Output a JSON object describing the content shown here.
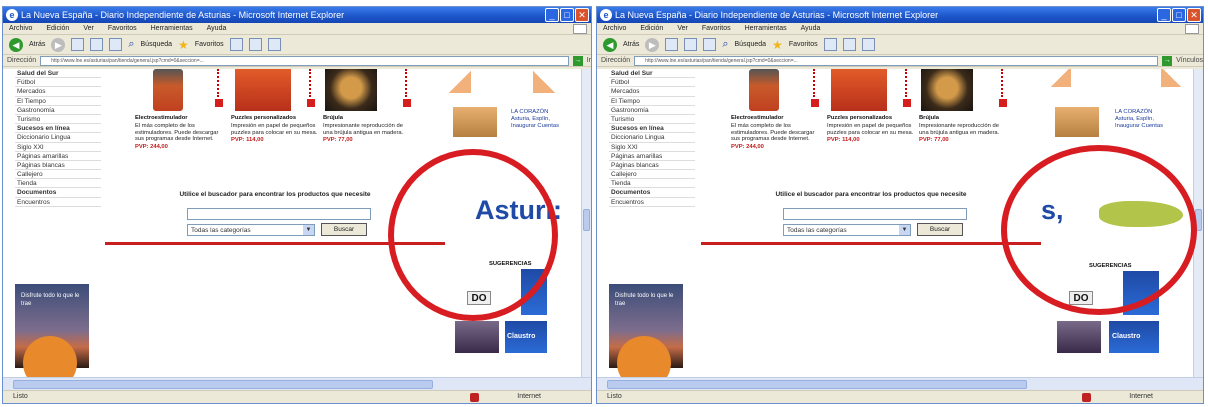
{
  "window": {
    "title": "La Nueva España - Diario Independiente de Asturias - Microsoft Internet Explorer",
    "menu": [
      "Archivo",
      "Edición",
      "Ver",
      "Favoritos",
      "Herramientas",
      "Ayuda"
    ],
    "back_label": "Atrás",
    "search_label": "Búsqueda",
    "favorites_label": "Favoritos",
    "address_label": "Dirección",
    "address_url": "http://www.lne.es/asturias/pan/tienda/general.jsp?cmd=0&seccion=...",
    "go_label": "Ir",
    "links_label": "Vínculos",
    "status_left": "Listo",
    "status_zone": "Internet"
  },
  "left_nav": [
    {
      "label": "Salud del Sur",
      "bold": true
    },
    {
      "label": "Fútbol",
      "bold": false
    },
    {
      "label": "Mercados",
      "bold": false
    },
    {
      "label": "El Tiempo",
      "bold": false
    },
    {
      "label": "Gastronomía",
      "bold": false
    },
    {
      "label": "Turismo",
      "bold": false
    },
    {
      "label": "Sucesos en línea",
      "bold": true
    },
    {
      "label": "Diccionario Lingua",
      "bold": false
    },
    {
      "label": "Siglo XXI",
      "bold": false
    },
    {
      "label": "Páginas amarillas",
      "bold": false
    },
    {
      "label": "Páginas blancas",
      "bold": false
    },
    {
      "label": "Callejero",
      "bold": false
    },
    {
      "label": "Tienda",
      "bold": false
    },
    {
      "label": "Documentos",
      "bold": true
    },
    {
      "label": "Encuentros",
      "bold": false
    }
  ],
  "promo": {
    "text": "Disfrute todo lo que le trae"
  },
  "products": [
    {
      "name": "Electroestimulador",
      "desc": "El más completo de los estimuladores. Puede descargar sus programas desde Internet.",
      "price": "PVP: 244,00"
    },
    {
      "name": "Puzzles personalizados",
      "desc": "Impresión en papel de pequeños puzzles para colocar en su mesa.",
      "price": "PVP: 114,00"
    },
    {
      "name": "Brújula",
      "desc": "Impresionante reproducción de una brújula antigua en madera.",
      "price": "PVP: 77,00"
    }
  ],
  "search": {
    "hint": "Utilice el buscador para encontrar los productos que necesite",
    "category_selected": "Todas las categorías",
    "button_label": "Buscar"
  },
  "right_col": {
    "side_text": "LA CORAZÓN Asturia, Esplín, Inaugurar Cuentas",
    "big_left": "Asturi:",
    "big_right": "s,",
    "sugerencias": "SUGERENCIAS",
    "do_logo": "DO",
    "tile_label": "Claustro"
  },
  "colors": {
    "oval": "#d71d22",
    "brand_blue": "#1f4aa6",
    "price_red": "#c21a1a"
  }
}
